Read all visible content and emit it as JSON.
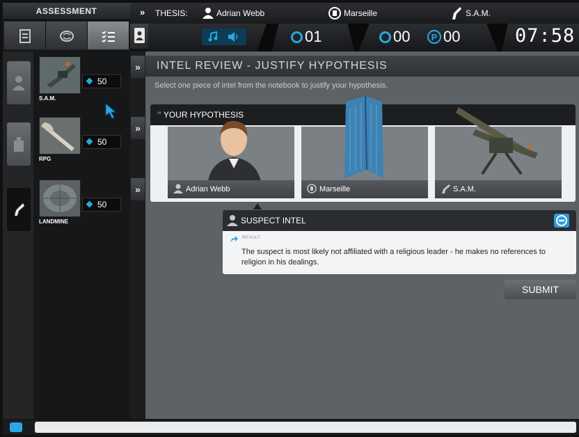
{
  "sidebar": {
    "header": "ASSESSMENT",
    "tabs": [
      {
        "name": "document-icon"
      },
      {
        "name": "brain-icon"
      },
      {
        "name": "checklist-icon",
        "active": true
      }
    ],
    "rail": [
      {
        "icon": "person-icon"
      },
      {
        "icon": "building-icon"
      },
      {
        "icon": "weapon-icon",
        "active": true
      }
    ],
    "weapons": [
      {
        "name": "S.A.M.",
        "cost": "50"
      },
      {
        "name": "RPG",
        "cost": "50"
      },
      {
        "name": "LANDMINE",
        "cost": "50"
      }
    ]
  },
  "topbar": {
    "thesis_label": "THESIS:",
    "suspect": "Adrian Webb",
    "location": "Marseille",
    "weapon": "S.A.M."
  },
  "status": {
    "attempts": "01",
    "bombs": "00",
    "points": "00",
    "points_token": "P",
    "timer": "07:58"
  },
  "main": {
    "title": "INTEL REVIEW - JUSTIFY HYPOTHESIS",
    "instruction": "Select one piece of intel from the notebook to justify your hypothesis.",
    "hypothesis": {
      "header": "YOUR HYPOTHESIS",
      "cards": [
        {
          "label": "Adrian Webb"
        },
        {
          "label": "Marseille"
        },
        {
          "label": "S.A.M."
        }
      ]
    },
    "intel": {
      "header": "SUSPECT INTEL",
      "result_label": "RESULT",
      "text": "The suspect is most likely not affiliated with a religious leader - he makes no references to religion in his dealings."
    },
    "submit_label": "SUBMIT"
  },
  "colors": {
    "accent": "#2aa7e2",
    "panel": "#5d6266",
    "dark": "#1d1e20"
  }
}
